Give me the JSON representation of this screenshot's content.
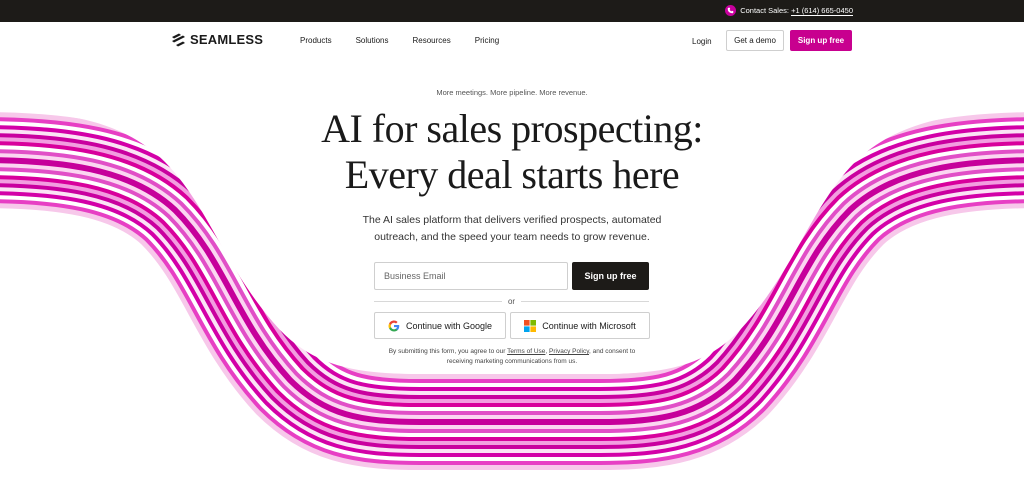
{
  "topbar": {
    "contact_label": "Contact Sales:",
    "contact_number": "+1 (614) 665-0450",
    "icon": "phone-icon"
  },
  "nav": {
    "logo_text": "SEAMLESS",
    "menu": [
      "Products",
      "Solutions",
      "Resources",
      "Pricing"
    ],
    "login": "Login",
    "demo": "Get a demo",
    "signup": "Sign up free"
  },
  "hero": {
    "eyebrow": "More meetings. More pipeline. More revenue.",
    "headline_line1": "AI for sales prospecting:",
    "headline_line2": "Every deal starts here",
    "sub_line1": "The AI sales platform that delivers verified prospects, automated",
    "sub_line2": "outreach, and the speed your team needs to grow revenue."
  },
  "form": {
    "email_placeholder": "Business Email",
    "email_value": "",
    "signup": "Sign up free",
    "or": "or",
    "google": "Continue with Google",
    "microsoft": "Continue with Microsoft"
  },
  "legal": {
    "prefix": "By submitting this form, you agree to our",
    "terms": "Terms of Use",
    "sep": ",",
    "privacy": "Privacy Policy",
    "suffix": ", and consent to",
    "line2": "receiving marketing communications from us."
  },
  "colors": {
    "brand_magenta": "#c8008f",
    "topbar_bg": "#1d1b18",
    "dark_button": "#1d1b18"
  }
}
